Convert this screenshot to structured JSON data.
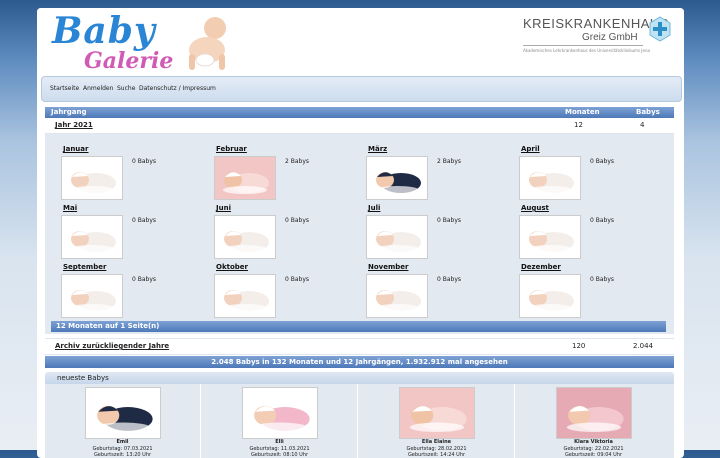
{
  "header": {
    "logo_line1": "Baby",
    "logo_line2": "Galerie",
    "hospital_name": "KREISKRANKENHAUS",
    "hospital_sub": "Greiz GmbH",
    "hospital_note": "Akademisches Lehrkrankenhaus des Universitätsklinikums Jena"
  },
  "nav": {
    "items": [
      "Startseite",
      "Anmelden",
      "Suche",
      "Datenschutz / Impressum"
    ]
  },
  "table": {
    "col_year": "Jahrgang",
    "col_months": "Monaten",
    "col_babies": "Babys",
    "year": {
      "label": "Jahr 2021",
      "months": "12",
      "babies": "4"
    }
  },
  "months": [
    {
      "name": "Januar",
      "count": "0 Babys"
    },
    {
      "name": "Februar",
      "count": "2 Babys"
    },
    {
      "name": "März",
      "count": "2 Babys"
    },
    {
      "name": "April",
      "count": "0 Babys"
    },
    {
      "name": "Mai",
      "count": "0 Babys"
    },
    {
      "name": "Juni",
      "count": "0 Babys"
    },
    {
      "name": "Juli",
      "count": "0 Babys"
    },
    {
      "name": "August",
      "count": "0 Babys"
    },
    {
      "name": "September",
      "count": "0 Babys"
    },
    {
      "name": "Oktober",
      "count": "0 Babys"
    },
    {
      "name": "November",
      "count": "0 Babys"
    },
    {
      "name": "Dezember",
      "count": "0 Babys"
    }
  ],
  "months_footer": "12 Monaten auf 1 Seite(n)",
  "archive": {
    "label": "Archiv zurückliegender Jahre",
    "months": "120",
    "babies": "2.044"
  },
  "summary": "2.048 Babys in 132 Monaten und 12 Jahrgängen, 1.932.912 mal angesehen",
  "newest": {
    "title": "neueste Babys",
    "babies": [
      {
        "name": "Emil",
        "birthday": "Geburtstag: 07.03.2021",
        "time": "Geburtszeit: 13:20 Uhr"
      },
      {
        "name": "Elli",
        "birthday": "Geburtstag: 11.03.2021",
        "time": "Geburtszeit: 08:10 Uhr"
      },
      {
        "name": "Ella Elaine",
        "birthday": "Geburtstag: 28.02.2021",
        "time": "Geburtszeit: 14:24 Uhr"
      },
      {
        "name": "Klara Viktoria",
        "birthday": "Geburtstag: 22.02.2021",
        "time": "Geburtszeit: 09:04 Uhr"
      }
    ]
  }
}
